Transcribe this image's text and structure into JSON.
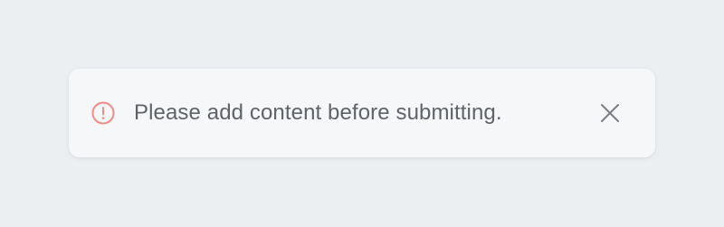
{
  "toast": {
    "message": "Please add content before submitting.",
    "icon": "alert-circle-icon",
    "close_icon": "close-icon",
    "colors": {
      "alert": "#ef8c87",
      "text": "#5f6368",
      "close": "#7a7d82",
      "background": "#f6f7f9",
      "page": "#eceff2"
    }
  }
}
